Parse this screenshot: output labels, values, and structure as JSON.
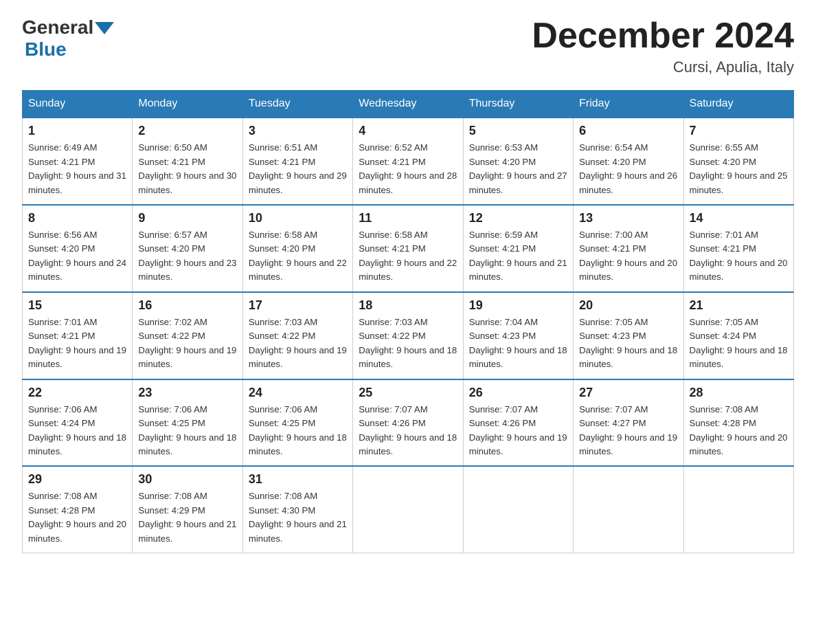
{
  "header": {
    "logo_general": "General",
    "logo_blue": "Blue",
    "month_title": "December 2024",
    "location": "Cursi, Apulia, Italy"
  },
  "days_of_week": [
    "Sunday",
    "Monday",
    "Tuesday",
    "Wednesday",
    "Thursday",
    "Friday",
    "Saturday"
  ],
  "weeks": [
    [
      {
        "day": "1",
        "sunrise": "6:49 AM",
        "sunset": "4:21 PM",
        "daylight": "9 hours and 31 minutes."
      },
      {
        "day": "2",
        "sunrise": "6:50 AM",
        "sunset": "4:21 PM",
        "daylight": "9 hours and 30 minutes."
      },
      {
        "day": "3",
        "sunrise": "6:51 AM",
        "sunset": "4:21 PM",
        "daylight": "9 hours and 29 minutes."
      },
      {
        "day": "4",
        "sunrise": "6:52 AM",
        "sunset": "4:21 PM",
        "daylight": "9 hours and 28 minutes."
      },
      {
        "day": "5",
        "sunrise": "6:53 AM",
        "sunset": "4:20 PM",
        "daylight": "9 hours and 27 minutes."
      },
      {
        "day": "6",
        "sunrise": "6:54 AM",
        "sunset": "4:20 PM",
        "daylight": "9 hours and 26 minutes."
      },
      {
        "day": "7",
        "sunrise": "6:55 AM",
        "sunset": "4:20 PM",
        "daylight": "9 hours and 25 minutes."
      }
    ],
    [
      {
        "day": "8",
        "sunrise": "6:56 AM",
        "sunset": "4:20 PM",
        "daylight": "9 hours and 24 minutes."
      },
      {
        "day": "9",
        "sunrise": "6:57 AM",
        "sunset": "4:20 PM",
        "daylight": "9 hours and 23 minutes."
      },
      {
        "day": "10",
        "sunrise": "6:58 AM",
        "sunset": "4:20 PM",
        "daylight": "9 hours and 22 minutes."
      },
      {
        "day": "11",
        "sunrise": "6:58 AM",
        "sunset": "4:21 PM",
        "daylight": "9 hours and 22 minutes."
      },
      {
        "day": "12",
        "sunrise": "6:59 AM",
        "sunset": "4:21 PM",
        "daylight": "9 hours and 21 minutes."
      },
      {
        "day": "13",
        "sunrise": "7:00 AM",
        "sunset": "4:21 PM",
        "daylight": "9 hours and 20 minutes."
      },
      {
        "day": "14",
        "sunrise": "7:01 AM",
        "sunset": "4:21 PM",
        "daylight": "9 hours and 20 minutes."
      }
    ],
    [
      {
        "day": "15",
        "sunrise": "7:01 AM",
        "sunset": "4:21 PM",
        "daylight": "9 hours and 19 minutes."
      },
      {
        "day": "16",
        "sunrise": "7:02 AM",
        "sunset": "4:22 PM",
        "daylight": "9 hours and 19 minutes."
      },
      {
        "day": "17",
        "sunrise": "7:03 AM",
        "sunset": "4:22 PM",
        "daylight": "9 hours and 19 minutes."
      },
      {
        "day": "18",
        "sunrise": "7:03 AM",
        "sunset": "4:22 PM",
        "daylight": "9 hours and 18 minutes."
      },
      {
        "day": "19",
        "sunrise": "7:04 AM",
        "sunset": "4:23 PM",
        "daylight": "9 hours and 18 minutes."
      },
      {
        "day": "20",
        "sunrise": "7:05 AM",
        "sunset": "4:23 PM",
        "daylight": "9 hours and 18 minutes."
      },
      {
        "day": "21",
        "sunrise": "7:05 AM",
        "sunset": "4:24 PM",
        "daylight": "9 hours and 18 minutes."
      }
    ],
    [
      {
        "day": "22",
        "sunrise": "7:06 AM",
        "sunset": "4:24 PM",
        "daylight": "9 hours and 18 minutes."
      },
      {
        "day": "23",
        "sunrise": "7:06 AM",
        "sunset": "4:25 PM",
        "daylight": "9 hours and 18 minutes."
      },
      {
        "day": "24",
        "sunrise": "7:06 AM",
        "sunset": "4:25 PM",
        "daylight": "9 hours and 18 minutes."
      },
      {
        "day": "25",
        "sunrise": "7:07 AM",
        "sunset": "4:26 PM",
        "daylight": "9 hours and 18 minutes."
      },
      {
        "day": "26",
        "sunrise": "7:07 AM",
        "sunset": "4:26 PM",
        "daylight": "9 hours and 19 minutes."
      },
      {
        "day": "27",
        "sunrise": "7:07 AM",
        "sunset": "4:27 PM",
        "daylight": "9 hours and 19 minutes."
      },
      {
        "day": "28",
        "sunrise": "7:08 AM",
        "sunset": "4:28 PM",
        "daylight": "9 hours and 20 minutes."
      }
    ],
    [
      {
        "day": "29",
        "sunrise": "7:08 AM",
        "sunset": "4:28 PM",
        "daylight": "9 hours and 20 minutes."
      },
      {
        "day": "30",
        "sunrise": "7:08 AM",
        "sunset": "4:29 PM",
        "daylight": "9 hours and 21 minutes."
      },
      {
        "day": "31",
        "sunrise": "7:08 AM",
        "sunset": "4:30 PM",
        "daylight": "9 hours and 21 minutes."
      },
      null,
      null,
      null,
      null
    ]
  ]
}
